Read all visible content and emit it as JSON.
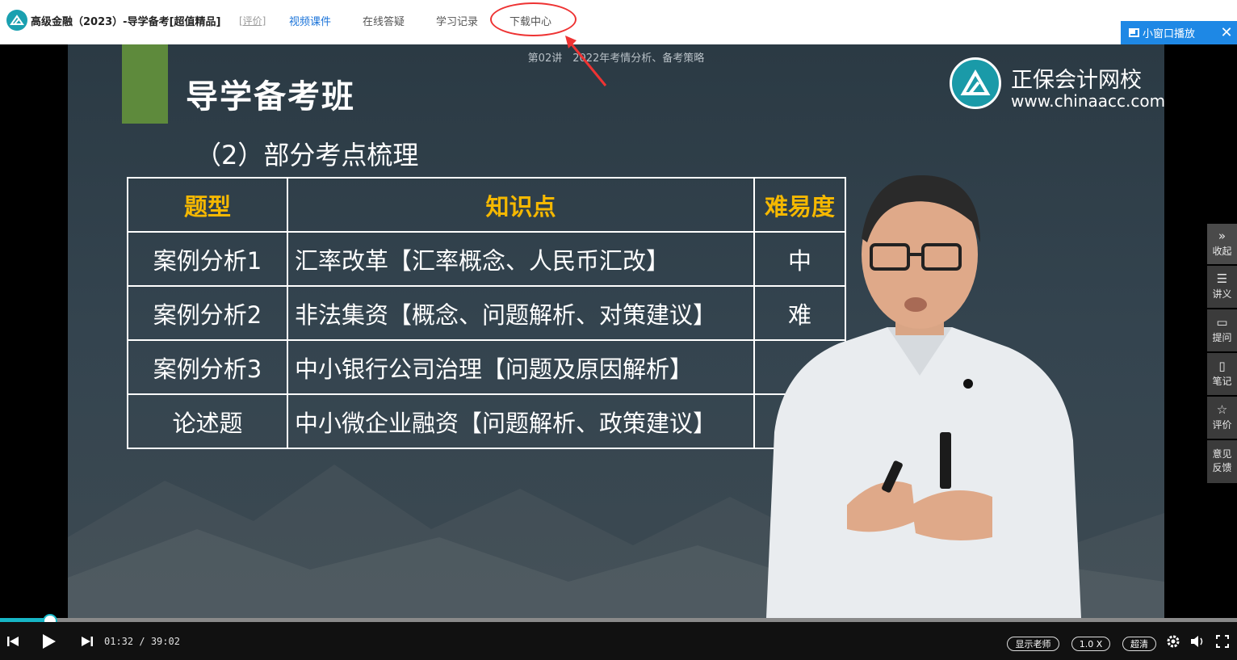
{
  "header": {
    "course_title": "高级金融（2023）-导学备考[超值精品]",
    "rate_link": "[评价]",
    "tabs": [
      "视频课件",
      "在线答疑",
      "学习记录",
      "下载中心"
    ],
    "active_tab_index": 0,
    "mini_window_label": "小窗口播放",
    "close_symbol": "✕"
  },
  "slide": {
    "caption": "第02讲　2022年考情分析、备考策略",
    "title": "导学备考班",
    "brand_name": "正保会计网校",
    "brand_url": "www.chinaacc.com",
    "subtitle": "（2）部分考点梳理",
    "table": {
      "headers": [
        "题型",
        "知识点",
        "难易度"
      ],
      "rows": [
        [
          "案例分析1",
          "汇率改革【汇率概念、人民币汇改】",
          "中"
        ],
        [
          "案例分析2",
          "非法集资【概念、问题解析、对策建议】",
          "难"
        ],
        [
          "案例分析3",
          "中小银行公司治理【问题及原因解析】",
          ""
        ],
        [
          "论述题",
          "中小微企业融资【问题解析、政策建议】",
          ""
        ]
      ]
    }
  },
  "side_panel": [
    {
      "icon": "chevron-right-icon",
      "glyph": "»",
      "label": "收起"
    },
    {
      "icon": "list-icon",
      "glyph": "☰",
      "label": "讲义"
    },
    {
      "icon": "comment-icon",
      "glyph": "▭",
      "label": "提问"
    },
    {
      "icon": "note-icon",
      "glyph": "▯",
      "label": "笔记"
    },
    {
      "icon": "star-icon",
      "glyph": "☆",
      "label": "评价"
    },
    {
      "icon": "feedback-icon",
      "glyph": "",
      "label": "意见反馈"
    }
  ],
  "player": {
    "current_time": "01:32",
    "separator": "/",
    "duration": "39:02",
    "progress_fraction": 0.039,
    "show_teacher_label": "显示老师",
    "speed_label": "1.0 X",
    "quality_label": "超清"
  },
  "colors": {
    "accent": "#17b6c6",
    "link_blue": "#1a73d9",
    "mini_button_bg": "#1e88e5",
    "table_header": "#f5b800",
    "slide_green": "#5e8a3c",
    "annotation_red": "#e33333"
  }
}
